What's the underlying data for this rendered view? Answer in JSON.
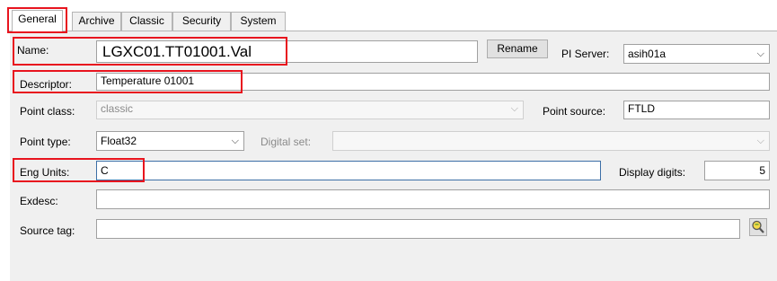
{
  "tabs": [
    {
      "label": "General",
      "active": true
    },
    {
      "label": "Archive",
      "active": false
    },
    {
      "label": "Classic",
      "active": false
    },
    {
      "label": "Security",
      "active": false
    },
    {
      "label": "System",
      "active": false
    }
  ],
  "form": {
    "name_label": "Name:",
    "name_value": "LGXC01.TT01001.Val",
    "rename_label": "Rename",
    "pi_server_label": "PI Server:",
    "pi_server_value": "asih01a",
    "descriptor_label": "Descriptor:",
    "descriptor_value": "Temperature 01001",
    "point_class_label": "Point class:",
    "point_class_value": "classic",
    "point_source_label": "Point source:",
    "point_source_value": "FTLD",
    "point_type_label": "Point type:",
    "point_type_value": "Float32",
    "digital_set_label": "Digital set:",
    "digital_set_value": "",
    "eng_units_label": "Eng Units:",
    "eng_units_value": "C",
    "display_digits_label": "Display digits:",
    "display_digits_value": "5",
    "exdesc_label": "Exdesc:",
    "exdesc_value": "",
    "source_tag_label": "Source tag:",
    "source_tag_value": ""
  },
  "icons": {
    "dropdown": "chevron-down-icon",
    "lookup": "magnifier-icon"
  },
  "colors": {
    "highlight": "#e8141e",
    "panel": "#f0f0f0"
  }
}
